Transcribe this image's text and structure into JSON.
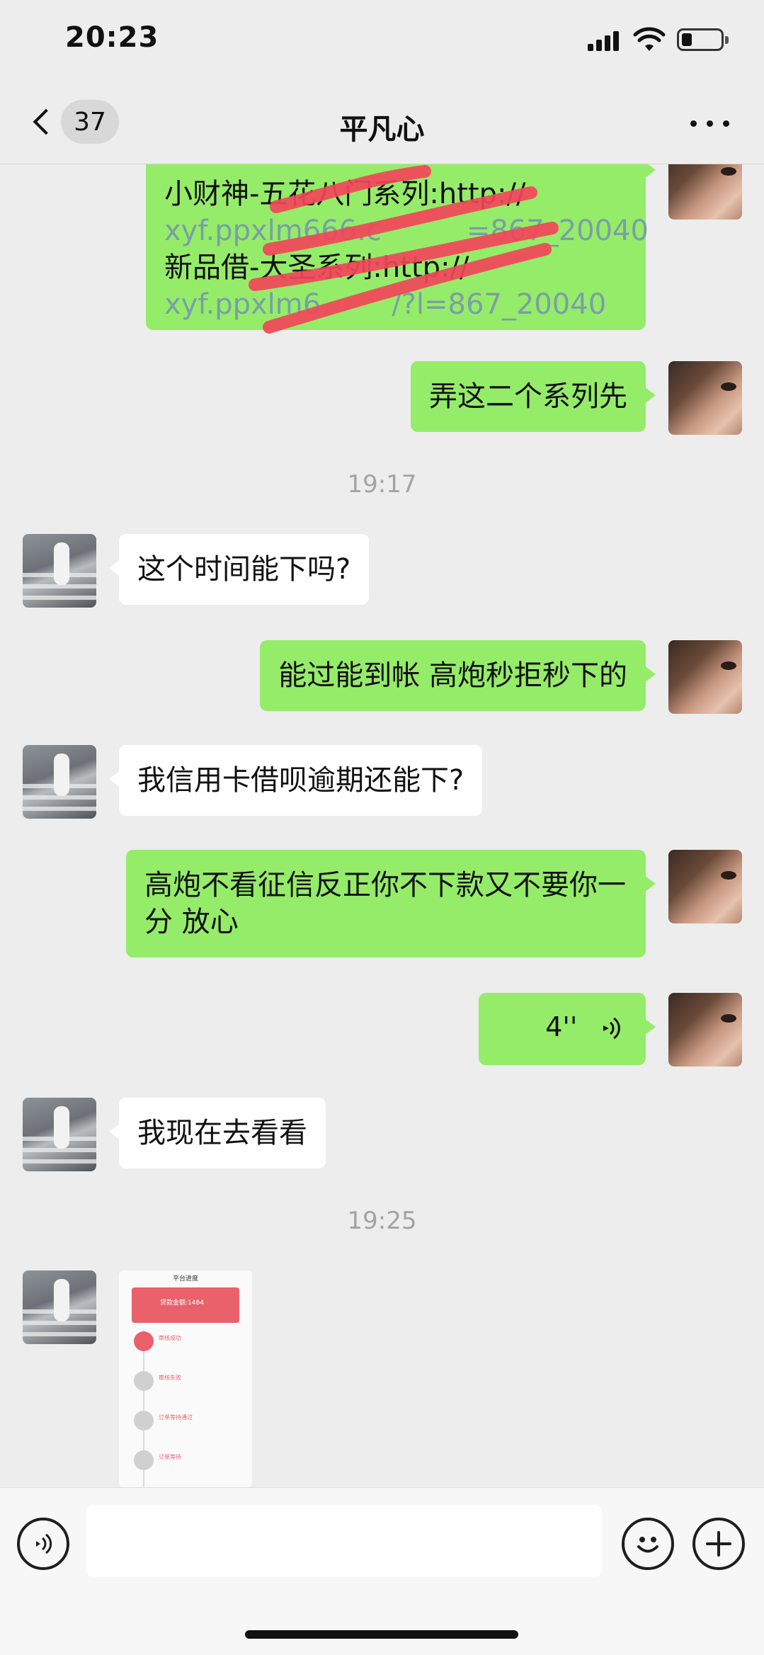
{
  "status_bar": {
    "time": "20:23"
  },
  "nav": {
    "back_count": "37",
    "title": "平凡心"
  },
  "messages": {
    "m1": {
      "line1": "小财神-五花八门系列:http://",
      "line2": "xyf.ppxlm666.c",
      "line2b": "=867_20040",
      "line3": "新品借-大圣系列:http://",
      "line4": "xyf.ppxlm6",
      "line4b": "/?l=867_20040"
    },
    "m2": "弄这二个系列先",
    "t1": "19:17",
    "m3": "这个时间能下吗?",
    "m4": "能过能到帐 高炮秒拒秒下的",
    "m5": "我信用卡借呗逾期还能下?",
    "m6": "高炮不看征信反正你不下款又不要你一分 放心",
    "m7_voice": "4''",
    "m8": "我现在去看看",
    "t2": "19:25"
  },
  "image_thumb": {
    "title": "平台进度",
    "card_text": "贷款金额:1484",
    "steps": [
      "审核成功",
      "审核失败",
      "订单等待通过",
      "订单等待"
    ]
  },
  "input": {
    "placeholder": ""
  },
  "colors": {
    "my_bubble": "#95ec69",
    "other_bubble": "#ffffff",
    "background": "#ededed"
  }
}
